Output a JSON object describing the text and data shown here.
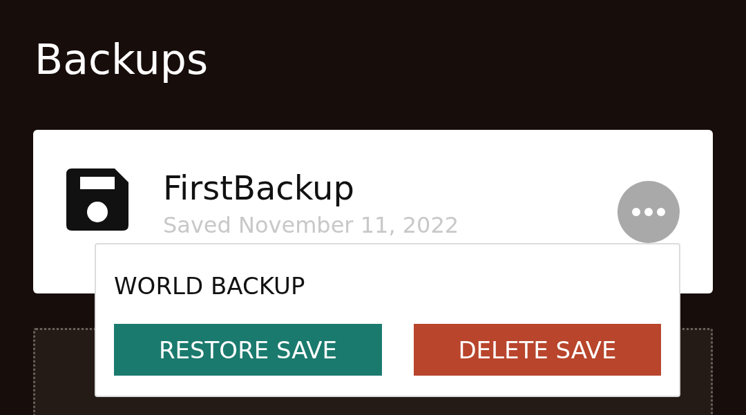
{
  "page": {
    "title": "Backups"
  },
  "backups": [
    {
      "name": "FirstBackup",
      "saved": "Saved November 11, 2022"
    }
  ],
  "menu": {
    "title": "WORLD BACKUP",
    "actions": [
      {
        "label": "RESTORE SAVE",
        "kind": "restore"
      },
      {
        "label": "DELETE SAVE",
        "kind": "delete"
      }
    ]
  }
}
